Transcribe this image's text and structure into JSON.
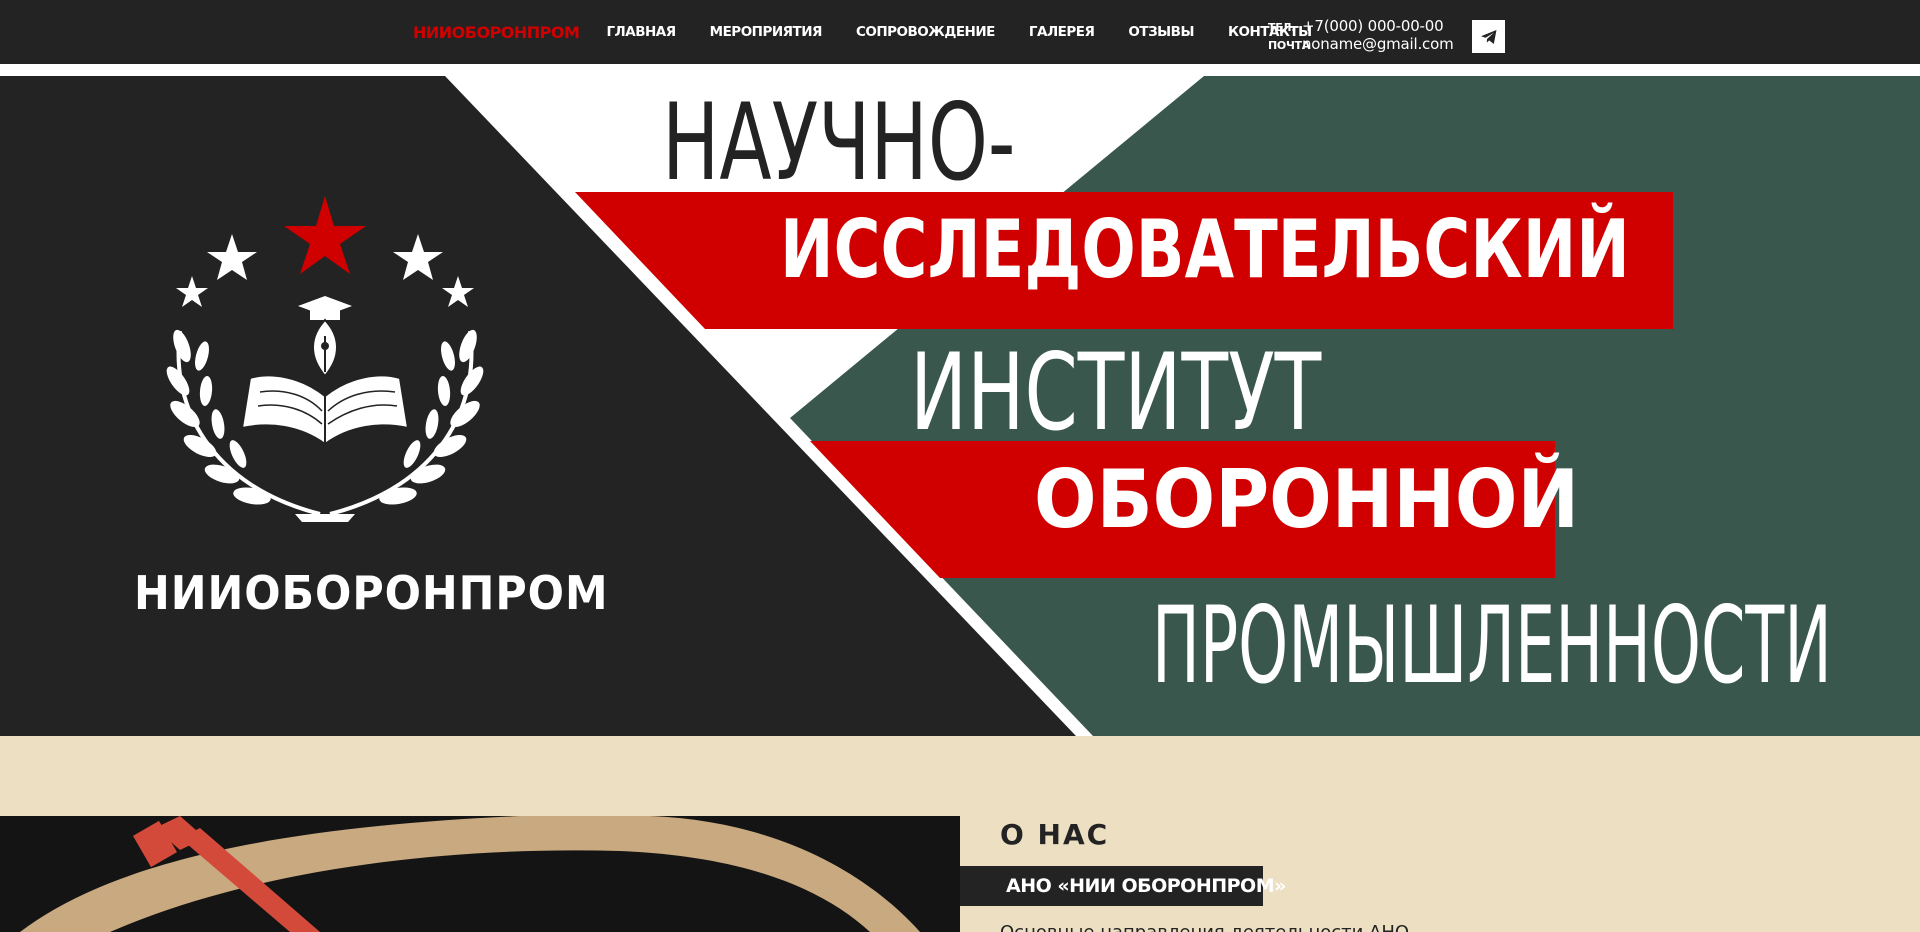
{
  "header": {
    "brand": "НИИОБОРОНПРОМ",
    "nav": [
      {
        "label": "ГЛАВНАЯ"
      },
      {
        "label": "МЕРОПРИЯТИЯ"
      },
      {
        "label": "СОПРОВОЖДЕНИЕ"
      },
      {
        "label": "ГАЛЕРЕЯ"
      },
      {
        "label": "ОТЗЫВЫ"
      },
      {
        "label": "КОНТАКТЫ"
      }
    ],
    "phone_label": "ТЕЛ.",
    "phone": "+7(000) 000-00-00",
    "email_label": "ПОЧТА",
    "email": "noname@gmail.com",
    "telegram_icon": "telegram-icon"
  },
  "hero": {
    "line1": "НАУЧНО-",
    "line2": "ИССЛЕДОВАТЕЛЬСКИЙ",
    "line3": "ИНСТИТУТ",
    "line4": "ОБОРОННОЙ",
    "line5": "ПРОМЫШЛЕННОСТИ",
    "logo_name": "НИИОБОРОНПРОМ",
    "logo_icon": "emblem-icon"
  },
  "about": {
    "title": "О НАС",
    "badge": "АНО «НИИ ОБОРОНПРОМ»",
    "text": "Основные направления деятельности АНО..."
  },
  "colors": {
    "dark": "#232323",
    "red": "#d10000",
    "green": "#3a574e",
    "beige": "#ecdfc2",
    "white": "#ffffff"
  }
}
